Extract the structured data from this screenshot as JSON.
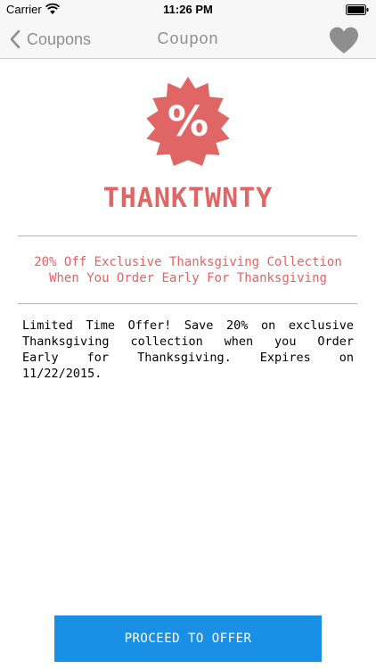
{
  "status_bar": {
    "carrier": "Carrier",
    "time": "11:26 PM"
  },
  "nav": {
    "back_label": "Coupons",
    "title": "Coupon",
    "favorite_icon": "heart-icon"
  },
  "coupon": {
    "badge_icon": "percent-badge-icon",
    "badge_symbol": "%",
    "code": "THANKTWNTY",
    "headline_lines": [
      "20% Off Exclusive Thanksgiving Collection",
      "When You Order Early For Thanksgiving"
    ],
    "description_lines": [
      "Limited Time Offer! Save 20% on exclusive",
      "Thanksgiving collection when you Order",
      "Early for Thanksgiving. Expires on",
      "11/22/2015."
    ]
  },
  "action": {
    "proceed_label": "PROCEED TO OFFER"
  },
  "colors": {
    "accent_red": "#e06666",
    "button_blue": "#1990e6",
    "nav_gray": "#8f8f8f"
  }
}
